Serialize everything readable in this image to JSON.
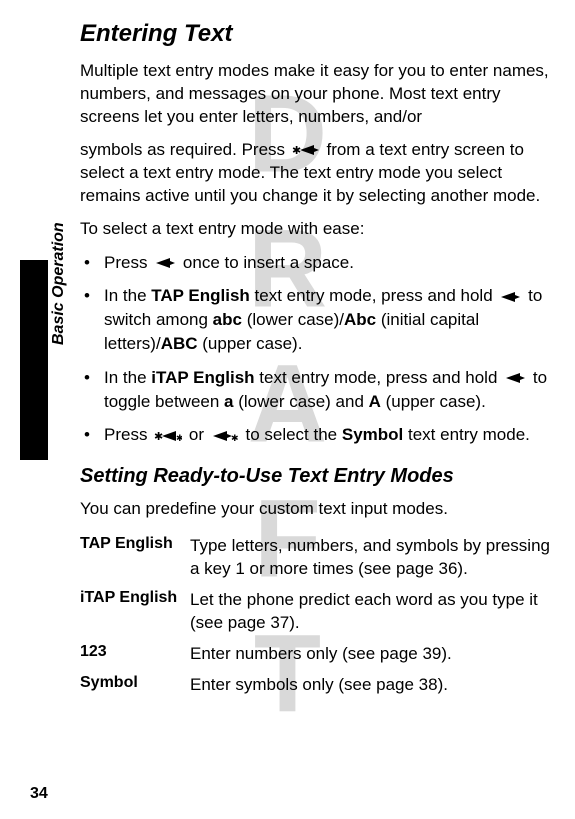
{
  "watermark": "DRAFT",
  "side_label": "Basic Operation",
  "page_number": "34",
  "h1": "Entering Text",
  "p1a": "Multiple text entry modes make it easy for you to enter names, numbers, and messages on your phone. Most text entry screens let you enter letters, numbers, and/or",
  "p1b_before": "symbols as required. Press ",
  "p1b_after": " from a text entry screen to select a text entry mode. The text entry mode you select remains active until you change it by selecting another mode.",
  "p2": "To select a text entry mode with ease:",
  "bullets": {
    "b1_before": "Press ",
    "b1_after": " once to insert a space.",
    "b2_a": "In the ",
    "b2_tap": "TAP English",
    "b2_b": " text entry mode, press and hold ",
    "b2_c": " to switch among ",
    "b2_abc_l": "abc",
    "b2_d": " (lower case)/",
    "b2_abc_i": "Abc",
    "b2_e": " (initial capital letters)/",
    "b2_abc_u": "ABC",
    "b2_f": " (upper case).",
    "b3_a": "In the ",
    "b3_itap": "iTAP English",
    "b3_b": " text entry mode, press and hold ",
    "b3_c": " to toggle between ",
    "b3_a_lower": "a",
    "b3_d": " (lower case) and ",
    "b3_a_upper": "A",
    "b3_e": " (upper case).",
    "b4_a": "Press ",
    "b4_b": " or ",
    "b4_c": " to select the ",
    "b4_symbol": "Symbol",
    "b4_d": " text entry mode."
  },
  "h2": "Setting Ready-to-Use Text Entry Modes",
  "p3": "You can predefine your custom text input modes.",
  "table": {
    "r1_l": "TAP English",
    "r1_r": "Type letters, numbers, and symbols by pressing a key 1 or more times (see page 36).",
    "r2_l": "iTAP English",
    "r2_r": "Let the phone predict each word as you type it (see page 37).",
    "r3_l": "123",
    "r3_r": "Enter numbers only (see page 39).",
    "r4_l": "Symbol",
    "r4_r": "Enter symbols only (see page 38)."
  }
}
